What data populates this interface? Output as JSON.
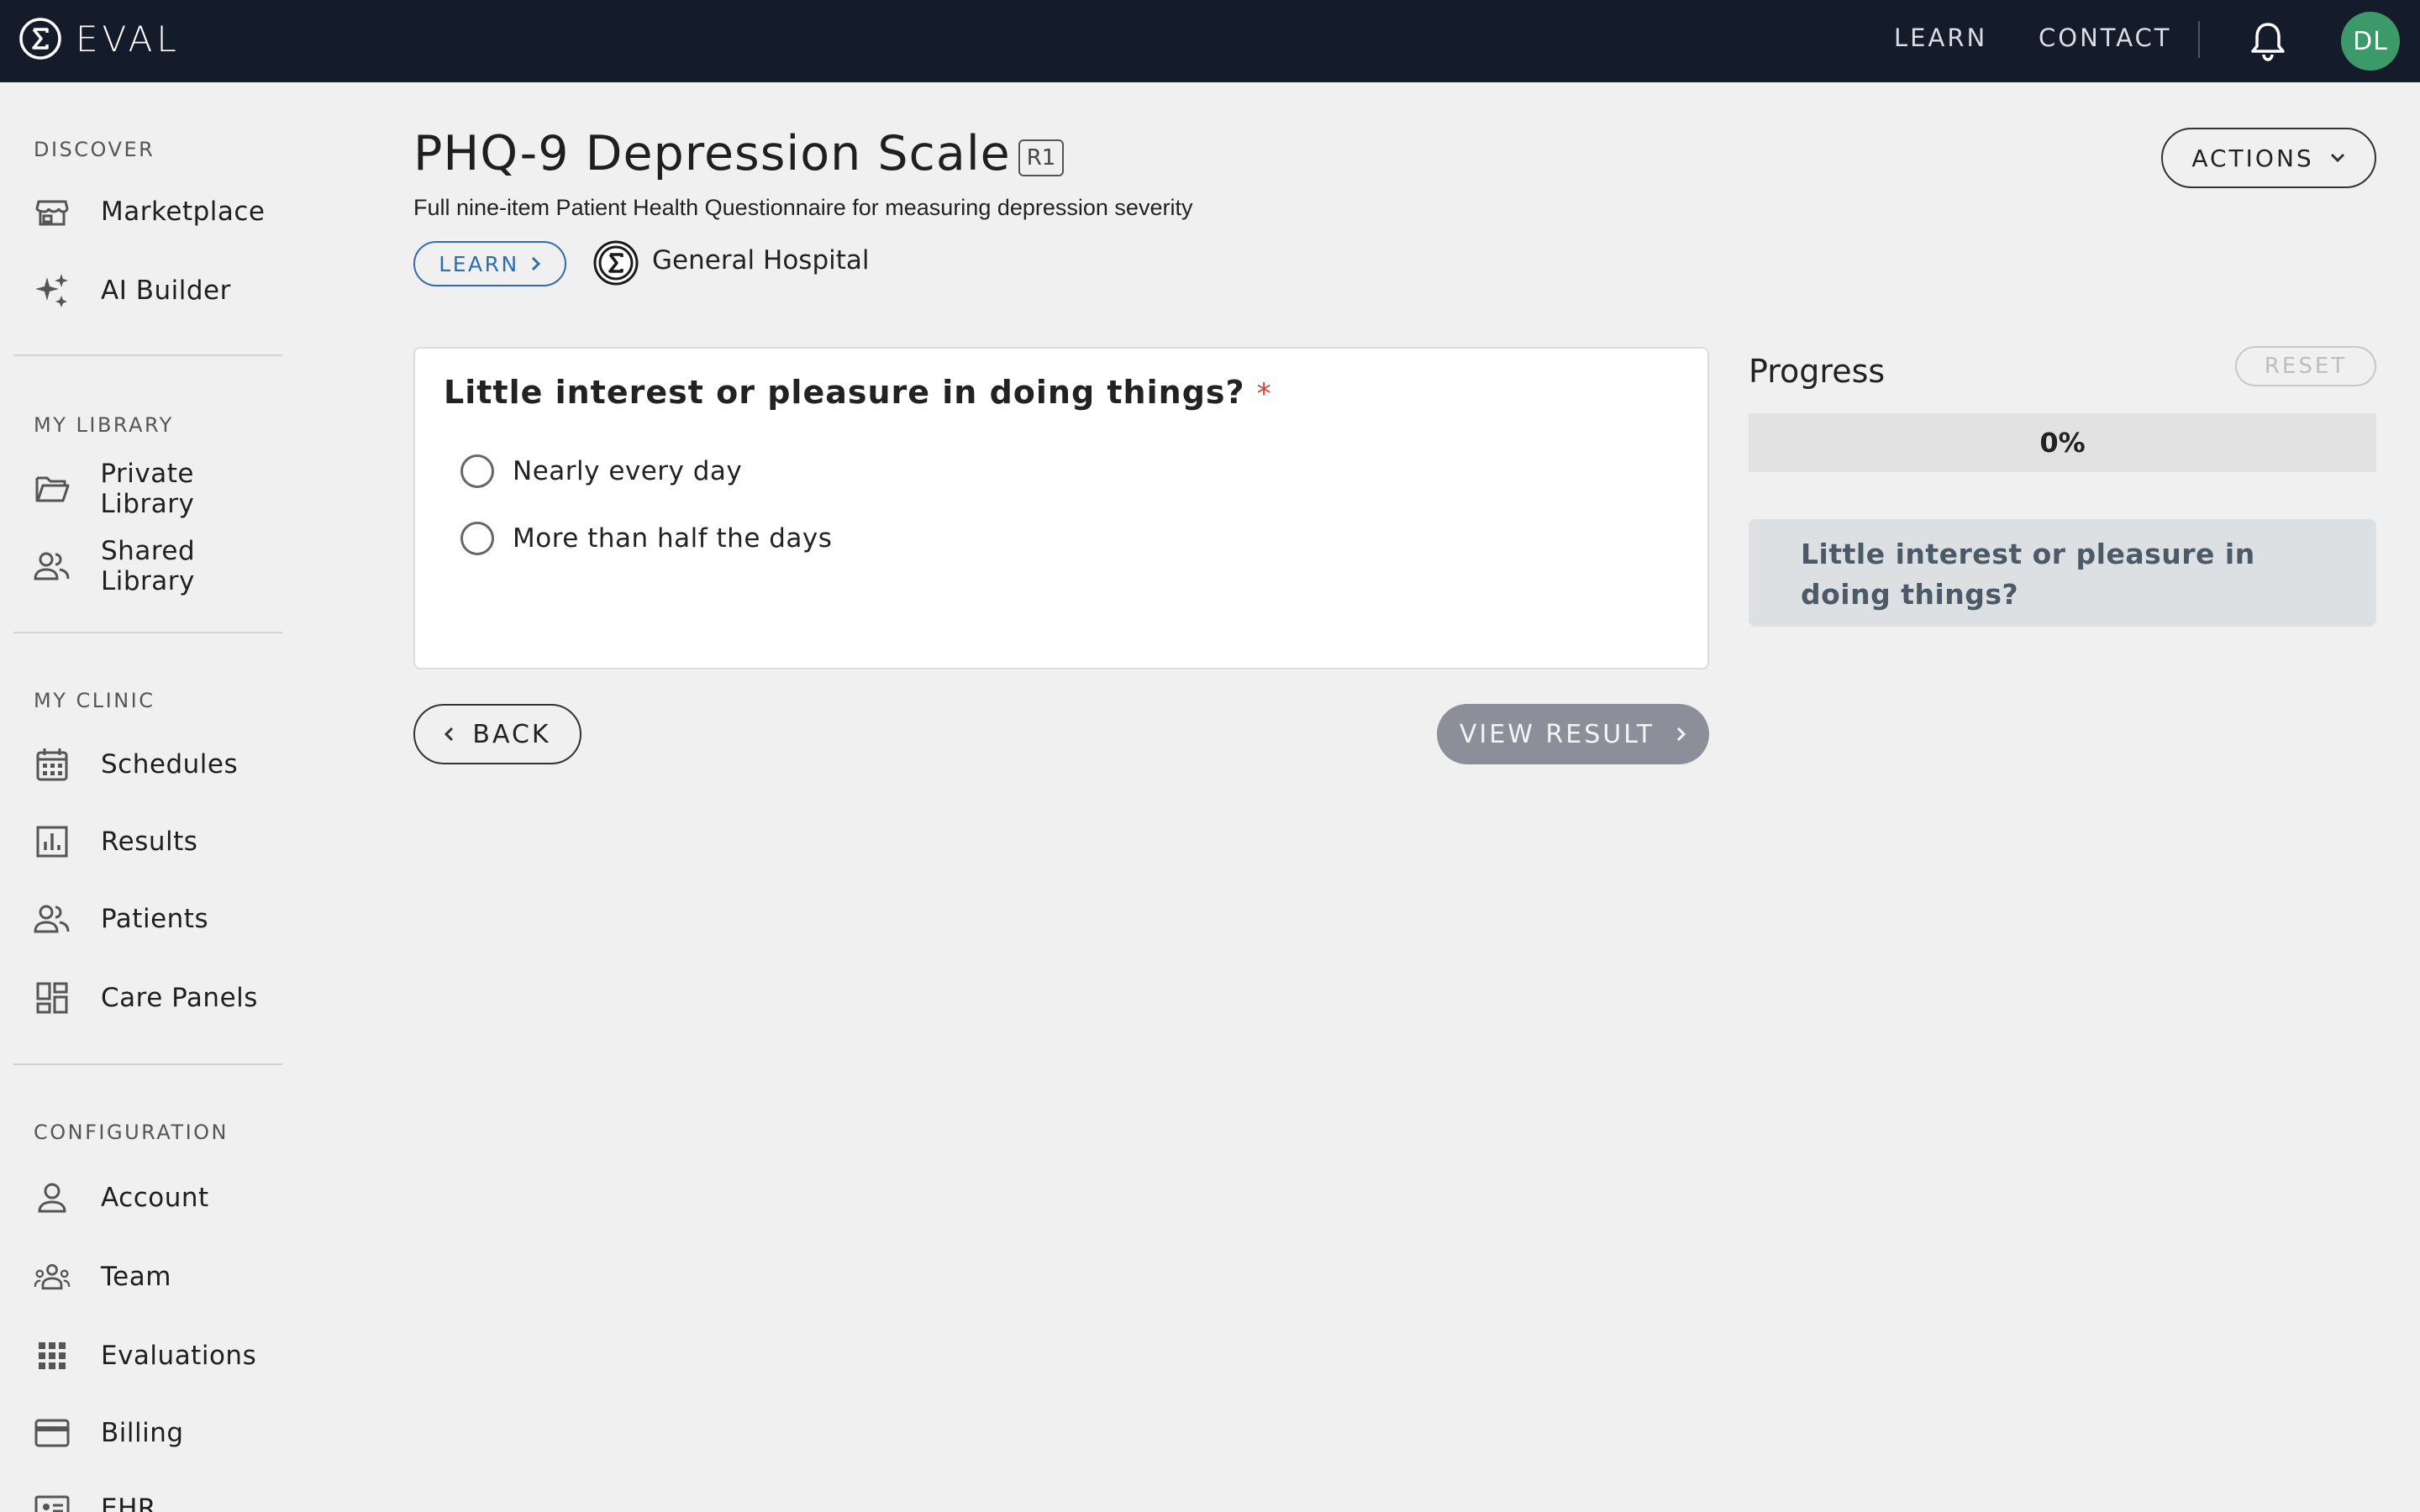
{
  "topbar": {
    "brand": "EVAL",
    "nav": [
      "LEARN",
      "CONTACT"
    ],
    "avatar_initials": "DL",
    "avatar_color": "#3c9a6a",
    "background": "#141b2b"
  },
  "sidebar": {
    "sections": [
      {
        "title": "DISCOVER",
        "items": [
          {
            "label": "Marketplace",
            "icon": "storefront-icon"
          },
          {
            "label": "AI Builder",
            "icon": "sparkles-icon"
          }
        ]
      },
      {
        "title": "MY LIBRARY",
        "items": [
          {
            "label": "Private Library",
            "icon": "folder-open-icon"
          },
          {
            "label": "Shared Library",
            "icon": "people-icon"
          }
        ]
      },
      {
        "title": "MY CLINIC",
        "items": [
          {
            "label": "Schedules",
            "icon": "calendar-icon"
          },
          {
            "label": "Results",
            "icon": "bar-chart-icon"
          },
          {
            "label": "Patients",
            "icon": "people-icon"
          },
          {
            "label": "Care Panels",
            "icon": "dashboard-icon"
          }
        ]
      },
      {
        "title": "CONFIGURATION",
        "items": [
          {
            "label": "Account",
            "icon": "person-icon"
          },
          {
            "label": "Team",
            "icon": "groups-icon"
          },
          {
            "label": "Evaluations",
            "icon": "apps-grid-icon"
          },
          {
            "label": "Billing",
            "icon": "credit-card-icon"
          },
          {
            "label": "EHR",
            "icon": "badge-icon"
          }
        ]
      }
    ]
  },
  "header": {
    "title": "PHQ-9 Depression Scale",
    "revision": "R1",
    "subtitle": "Full nine-item Patient Health Questionnaire for measuring depression severity",
    "learn_label": "LEARN",
    "organization": "General Hospital",
    "actions_label": "ACTIONS"
  },
  "question": {
    "text": "Little interest or pleasure in doing things?",
    "required_marker": "*",
    "options": [
      "Nearly every day",
      "More than half the days"
    ]
  },
  "navigation": {
    "back_label": "BACK",
    "result_label": "VIEW RESULT"
  },
  "progress": {
    "title": "Progress",
    "reset_label": "RESET",
    "percent": 0,
    "percent_label": "0%",
    "items": [
      "Little interest or pleasure in doing things?"
    ]
  }
}
